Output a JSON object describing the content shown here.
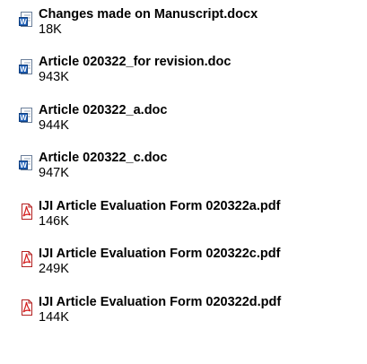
{
  "attachments": [
    {
      "name": "Changes made on Manuscript.docx",
      "size": "18K",
      "icon": "word-document-icon"
    },
    {
      "name": "Article 020322_for revision.doc",
      "size": "943K",
      "icon": "word-document-icon"
    },
    {
      "name": "Article 020322_a.doc",
      "size": "944K",
      "icon": "word-document-icon"
    },
    {
      "name": "Article 020322_c.doc",
      "size": "947K",
      "icon": "word-document-icon"
    },
    {
      "name": "IJI Article Evaluation Form 020322a.pdf",
      "size": "146K",
      "icon": "pdf-document-icon"
    },
    {
      "name": "IJI Article Evaluation Form 020322c.pdf",
      "size": "249K",
      "icon": "pdf-document-icon"
    },
    {
      "name": "IJI Article Evaluation Form 020322d.pdf",
      "size": "144K",
      "icon": "pdf-document-icon"
    }
  ],
  "colors": {
    "word_blue": "#1d5fb8",
    "pdf_red": "#d61f1f",
    "text": "#000000"
  }
}
